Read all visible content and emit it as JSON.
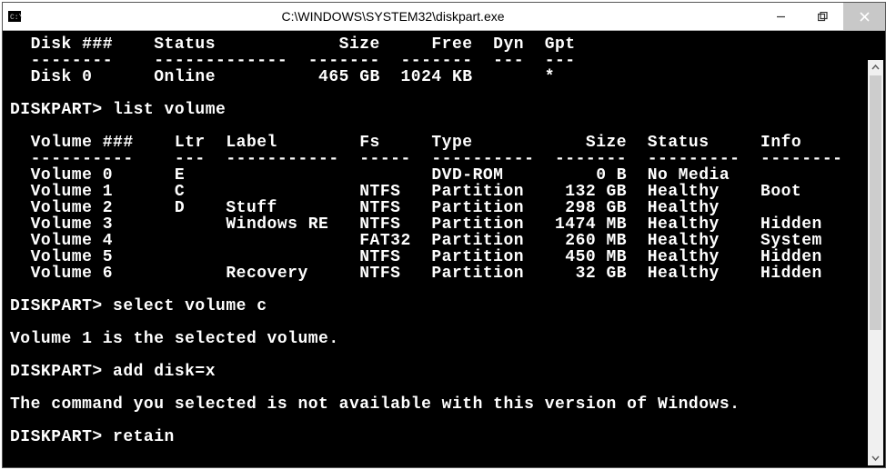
{
  "window": {
    "title": "C:\\WINDOWS\\SYSTEM32\\diskpart.exe"
  },
  "disk_table": {
    "cols": [
      {
        "label": "Disk ###",
        "w": 10
      },
      {
        "label": "Status",
        "w": 13
      },
      {
        "label": "Size",
        "w": 7,
        "align": "right"
      },
      {
        "label": "Free",
        "w": 7,
        "align": "right"
      },
      {
        "label": "Dyn",
        "w": 3,
        "post": 2
      },
      {
        "label": "Gpt",
        "w": 3
      }
    ],
    "dash_widths": [
      8,
      13,
      7,
      7,
      3,
      3
    ],
    "rows": [
      {
        "c": [
          "Disk 0",
          "Online",
          "465 GB",
          "1024 KB",
          "",
          "*"
        ]
      }
    ]
  },
  "cmd1": {
    "prompt": "DISKPART> ",
    "cmd": "list volume"
  },
  "vol_table": {
    "cols": [
      {
        "label": "Volume ###",
        "w": 12
      },
      {
        "label": "Ltr",
        "w": 3,
        "post": 2
      },
      {
        "label": "Label",
        "w": 11,
        "post": 2
      },
      {
        "label": "Fs",
        "w": 5,
        "post": 2
      },
      {
        "label": "Type",
        "w": 10,
        "post": 2
      },
      {
        "label": "Size",
        "w": 7,
        "align": "right",
        "post": 2
      },
      {
        "label": "Status",
        "w": 9,
        "post": 2
      },
      {
        "label": "Info",
        "w": 8
      }
    ],
    "dash_widths": [
      10,
      3,
      11,
      5,
      10,
      7,
      9,
      8
    ],
    "rows": [
      {
        "c": [
          "Volume 0",
          "E",
          "",
          "",
          "DVD-ROM",
          "0 B",
          "No Media",
          ""
        ]
      },
      {
        "c": [
          "Volume 1",
          "C",
          "",
          "NTFS",
          "Partition",
          "132 GB",
          "Healthy",
          "Boot"
        ]
      },
      {
        "c": [
          "Volume 2",
          "D",
          "Stuff",
          "NTFS",
          "Partition",
          "298 GB",
          "Healthy",
          ""
        ]
      },
      {
        "c": [
          "Volume 3",
          "",
          "Windows RE",
          "NTFS",
          "Partition",
          "1474 MB",
          "Healthy",
          "Hidden"
        ]
      },
      {
        "c": [
          "Volume 4",
          "",
          "",
          "FAT32",
          "Partition",
          "260 MB",
          "Healthy",
          "System"
        ]
      },
      {
        "c": [
          "Volume 5",
          "",
          "",
          "NTFS",
          "Partition",
          "450 MB",
          "Healthy",
          "Hidden"
        ]
      },
      {
        "c": [
          "Volume 6",
          "",
          "Recovery",
          "NTFS",
          "Partition",
          "32 GB",
          "Healthy",
          "Hidden"
        ]
      }
    ]
  },
  "cmd2": {
    "prompt": "DISKPART> ",
    "cmd": "select volume c"
  },
  "msg1": "Volume 1 is the selected volume.",
  "cmd3": {
    "prompt": "DISKPART> ",
    "cmd": "add disk=x"
  },
  "msg2": "The command you selected is not available with this version of Windows.",
  "cmd4": {
    "prompt": "DISKPART> ",
    "cmd": "retain"
  }
}
